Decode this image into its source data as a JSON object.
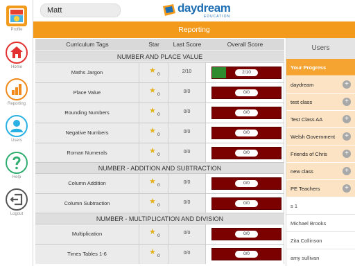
{
  "topbar": {
    "user_value": "Matt",
    "logo_text": "daydream",
    "logo_sub": "EDUCATION"
  },
  "nav": {
    "profile": "Profile",
    "home": "Home",
    "reporting": "Reporting",
    "users": "Users",
    "help": "Help",
    "logout": "Logout"
  },
  "header": {
    "title": "Reporting"
  },
  "table": {
    "columns": [
      "Curriculum Tags",
      "Star",
      "Last Score",
      "Overall Score"
    ],
    "sections": [
      {
        "title": "NUMBER AND PLACE VALUE"
      },
      {
        "title": "NUMBER - ADDITION AND SUBTRACTION"
      },
      {
        "title": "NUMBER - MULTIPLICATION AND DIVISION"
      }
    ],
    "rows": [
      {
        "tag": "Maths Jargon",
        "stars": "0",
        "last": "2/10",
        "overall": "2/10",
        "progress": 0.2
      },
      {
        "tag": "Place Value",
        "stars": "0",
        "last": "0/0",
        "overall": "0/0",
        "progress": 0
      },
      {
        "tag": "Rounding Numbers",
        "stars": "0",
        "last": "0/0",
        "overall": "0/0",
        "progress": 0
      },
      {
        "tag": "Negative Numbers",
        "stars": "0",
        "last": "0/0",
        "overall": "0/0",
        "progress": 0
      },
      {
        "tag": "Roman Numerals",
        "stars": "0",
        "last": "0/0",
        "overall": "0/0",
        "progress": 0
      },
      {
        "tag": "Column Addition",
        "stars": "0",
        "last": "0/0",
        "overall": "0/0",
        "progress": 0
      },
      {
        "tag": "Column Subtraction",
        "stars": "0",
        "last": "0/0",
        "overall": "0/0",
        "progress": 0
      },
      {
        "tag": "Multiplication",
        "stars": "0",
        "last": "0/0",
        "overall": "0/0",
        "progress": 0
      },
      {
        "tag": "Times Tables 1-6",
        "stars": "0",
        "last": "0/0",
        "overall": "0/0",
        "progress": 0
      }
    ]
  },
  "users": {
    "title": "Users",
    "items": [
      {
        "label": "Your Progress",
        "kind": "active"
      },
      {
        "label": "daydream",
        "kind": "group"
      },
      {
        "label": "test class",
        "kind": "group"
      },
      {
        "label": "Test Class AA",
        "kind": "group"
      },
      {
        "label": "Welsh Government",
        "kind": "group"
      },
      {
        "label": "Friends of Chris",
        "kind": "group"
      },
      {
        "label": "new class",
        "kind": "group"
      },
      {
        "label": "PE Teachers",
        "kind": "group"
      },
      {
        "label": "s 1",
        "kind": "person"
      },
      {
        "label": "Michael Brooks",
        "kind": "person"
      },
      {
        "label": "Zita Collinson",
        "kind": "person"
      },
      {
        "label": "amy sullivan",
        "kind": "person"
      }
    ]
  },
  "colors": {
    "accent": "#f39a1a",
    "score_bad": "#7b0000",
    "score_good": "#2e8b2e",
    "home": "#e33131",
    "reporting": "#f08a1c",
    "users": "#2ab1e3",
    "help": "#2fae6f",
    "logout": "#555555"
  }
}
